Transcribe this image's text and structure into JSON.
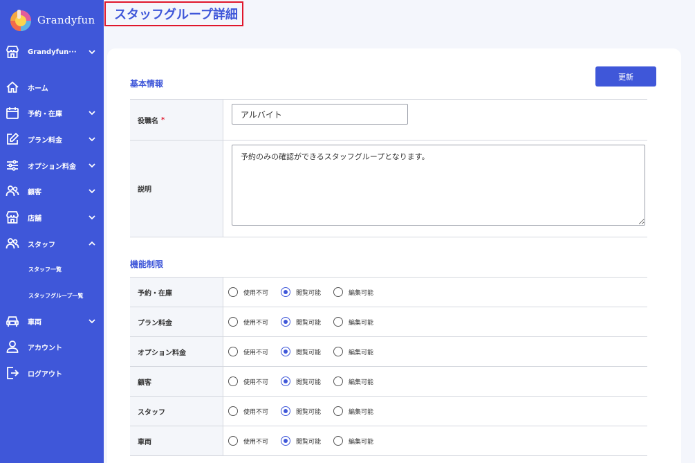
{
  "app": {
    "name": "Grandyfun"
  },
  "page": {
    "title": "スタッフグループ詳細"
  },
  "sidebar": {
    "store_selector": "Grandyfun···",
    "items": [
      {
        "label": "ホーム",
        "icon": "home-icon"
      },
      {
        "label": "予約・在庫",
        "icon": "calendar-icon"
      },
      {
        "label": "プラン料金",
        "icon": "edit-icon"
      },
      {
        "label": "オプション料金",
        "icon": "sliders-icon"
      },
      {
        "label": "顧客",
        "icon": "users-icon"
      },
      {
        "label": "店舗",
        "icon": "store-icon"
      },
      {
        "label": "スタッフ",
        "icon": "staff-icon"
      },
      {
        "label": "車両",
        "icon": "car-icon"
      },
      {
        "label": "アカウント",
        "icon": "account-icon"
      },
      {
        "label": "ログアウト",
        "icon": "logout-icon"
      }
    ],
    "staff_sub": [
      "スタッフ一覧",
      "スタッフグループ一覧"
    ]
  },
  "basic": {
    "section_title": "基本情報",
    "update_label": "更新",
    "role_label": "役職名",
    "required_mark": "*",
    "role_value": "アルバイト",
    "desc_label": "説明",
    "desc_value": "予約のみの確認ができるスタッフグループとなります。"
  },
  "permissions": {
    "section_title": "機能制限",
    "options": [
      "使用不可",
      "閲覧可能",
      "編集可能"
    ],
    "rows": [
      {
        "label": "予約・在庫",
        "selected": "閲覧可能"
      },
      {
        "label": "プラン料金",
        "selected": "閲覧可能"
      },
      {
        "label": "オプション料金",
        "selected": "閲覧可能"
      },
      {
        "label": "顧客",
        "selected": "閲覧可能"
      },
      {
        "label": "スタッフ",
        "selected": "閲覧可能"
      },
      {
        "label": "車両",
        "selected": "閲覧可能"
      }
    ]
  },
  "colors": {
    "primary": "#3f57d9",
    "highlight": "#e0162b"
  }
}
